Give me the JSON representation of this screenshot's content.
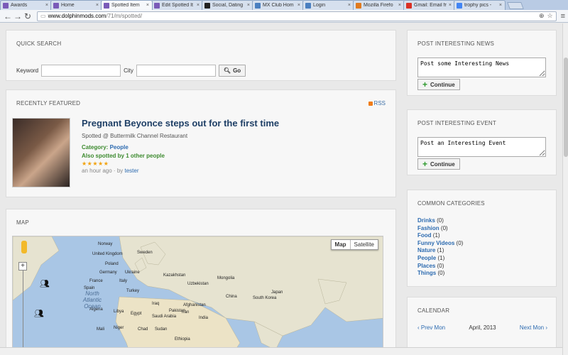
{
  "browser": {
    "tabs": [
      {
        "label": "Awards",
        "favicon_color": "#7a5bb8",
        "active": false
      },
      {
        "label": "Home",
        "favicon_color": "#7a5bb8",
        "active": false
      },
      {
        "label": "Spotted Item",
        "favicon_color": "#7a5bb8",
        "active": true
      },
      {
        "label": "Edit Spotted It",
        "favicon_color": "#7a5bb8",
        "active": false
      },
      {
        "label": "Social, Dating",
        "favicon_color": "#222222",
        "active": false
      },
      {
        "label": "MX Club Hom",
        "favicon_color": "#4a7fc0",
        "active": false
      },
      {
        "label": "Login",
        "favicon_color": "#4a7fc0",
        "active": false
      },
      {
        "label": "Mozilla Firefo",
        "favicon_color": "#e07a1f",
        "active": false
      },
      {
        "label": "Gmail: Email fr",
        "favicon_color": "#d93025",
        "active": false
      },
      {
        "label": "trophy pics -",
        "favicon_color": "#4285f4",
        "active": false
      }
    ],
    "url_host": "www.dolphinmods.com",
    "url_path": "/71/m/spotted/"
  },
  "quick_search": {
    "title": "QUICK SEARCH",
    "keyword_label": "Keyword",
    "city_label": "City",
    "keyword_value": "",
    "city_value": "",
    "go_label": "Go"
  },
  "featured": {
    "title": "RECENTLY FEATURED",
    "rss_label": "RSS",
    "item_title": "Pregnant Beyonce steps out for the first time",
    "spotted_at": "Spotted @ Buttermilk Channel Restaurant",
    "category_label": "Category:",
    "category_value": "People",
    "also_spotted": "Also spotted by 1 other people",
    "stars": "★★★★★",
    "time_ago": "an hour ago · by",
    "author": "tester"
  },
  "map": {
    "title": "MAP",
    "type_map": "Map",
    "type_satellite": "Satellite",
    "labels": [
      "Norway",
      "Sweden",
      "United Kingdom",
      "Poland",
      "Germany",
      "Ukraine",
      "France",
      "Italy",
      "Spain",
      "Kazakhstan",
      "Mongolia",
      "Turkey",
      "Uzbekistan",
      "China",
      "Japan",
      "South Korea",
      "Afghanistan",
      "Iraq",
      "Iran",
      "Pakistan",
      "Algeria",
      "Libya",
      "Egypt",
      "Saudi Arabia",
      "India",
      "Mali",
      "Niger",
      "Chad",
      "Sudan",
      "Ethiopia"
    ],
    "ocean": "North Atlantic Ocean"
  },
  "post_news": {
    "title": "POST INTERESTING NEWS",
    "placeholder": "Post some Interesting News",
    "continue_label": "Continue"
  },
  "post_event": {
    "title": "POST INTERESTING EVENT",
    "placeholder": "Post an Interesting Event",
    "continue_label": "Continue"
  },
  "categories": {
    "title": "COMMON CATEGORIES",
    "items": [
      {
        "name": "Drinks",
        "count": "(0)"
      },
      {
        "name": "Fashion",
        "count": "(0)"
      },
      {
        "name": "Food",
        "count": "(1)"
      },
      {
        "name": "Funny Videos",
        "count": "(0)"
      },
      {
        "name": "Nature",
        "count": "(1)"
      },
      {
        "name": "People",
        "count": "(1)"
      },
      {
        "name": "Places",
        "count": "(0)"
      },
      {
        "name": "Things",
        "count": "(0)"
      }
    ]
  },
  "calendar": {
    "title": "CALENDAR",
    "prev": "‹ Prev Mon",
    "month": "April, 2013",
    "next": "Next Mon ›"
  },
  "admin_bar": {
    "username": "tester"
  }
}
